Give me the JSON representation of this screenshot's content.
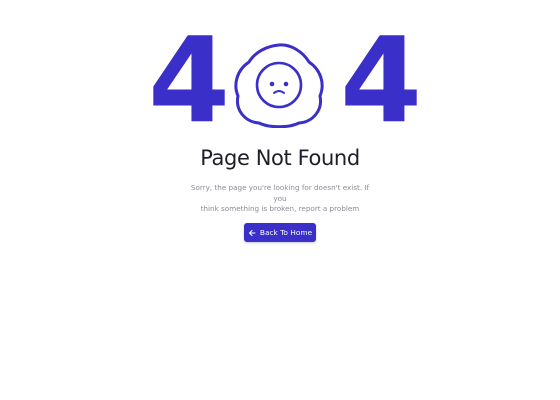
{
  "colors": {
    "accent": "#3a2fc9",
    "text_dark": "#1e1e2a",
    "text_muted": "#8a8a96",
    "background": "#ffffff"
  },
  "hero": {
    "digit_left": "4",
    "digit_right": "4",
    "center_icon": "sad-egg-icon"
  },
  "title": "Page Not Found",
  "message": {
    "line1": "Sorry, the page you're looking for doesn't exist. If you",
    "line2": "think something is broken, report a problem"
  },
  "back_button": {
    "label": "Back To Home",
    "icon": "arrow-left-icon"
  }
}
